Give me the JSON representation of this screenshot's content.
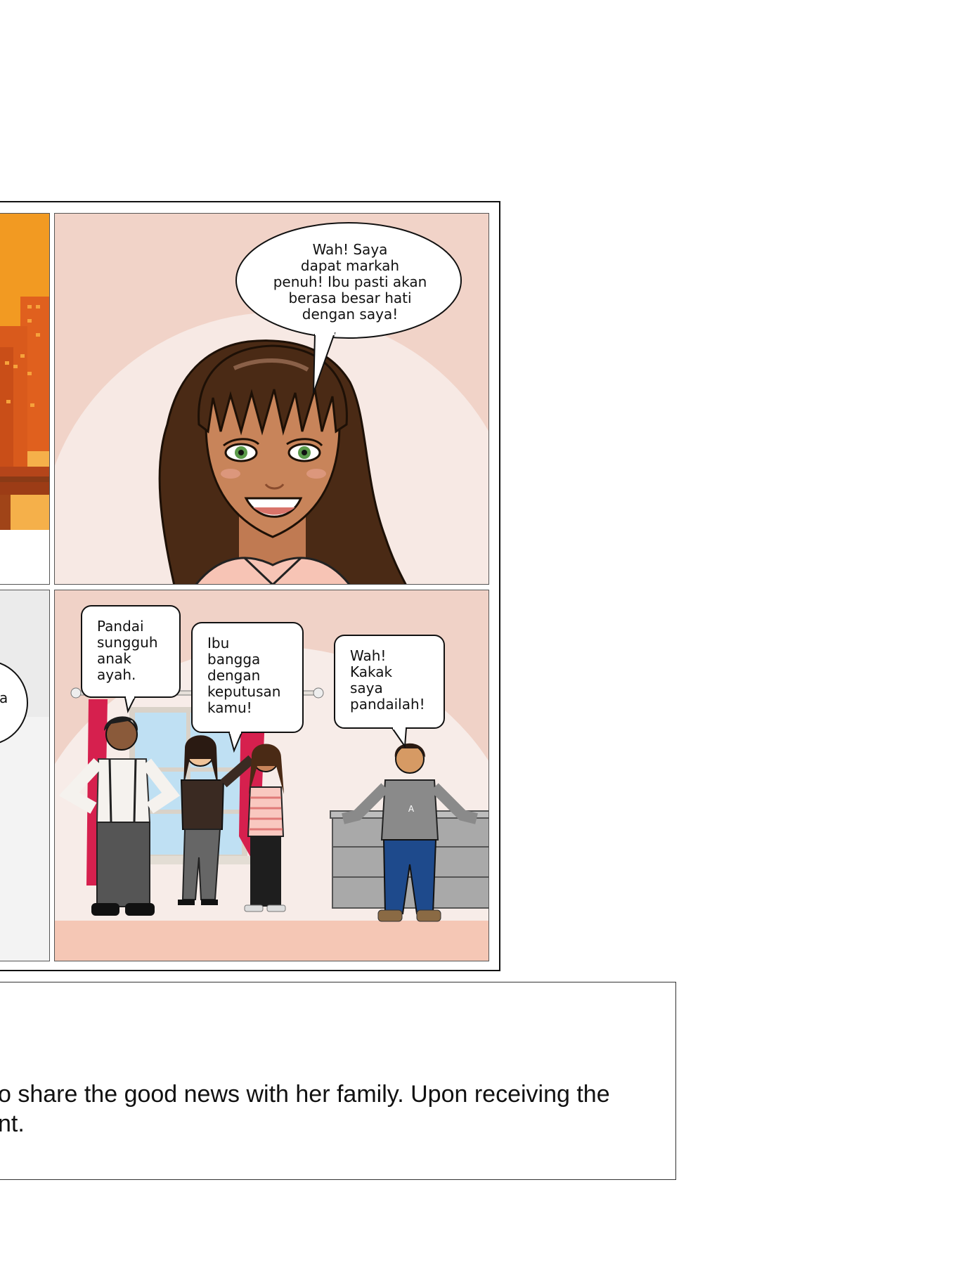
{
  "comic": {
    "panel_top_right": {
      "speech": "Wah! Saya\ndapat markah\npenuh! Ibu pasti akan\nberasa besar hati\ndengan saya!"
    },
    "panel_bottom_left": {
      "speech_fragment": "a"
    },
    "panel_bottom_right": {
      "speech_father": "Pandai\nsungguh\nanak\nayah.",
      "speech_mother": "Ibu\nbangga\ndengan\nkeputusan\nkamu!",
      "speech_brother": "Wah!\nKakak\nsaya\npandailah!",
      "hoodie_letter": "A"
    }
  },
  "caption": {
    "text": "o share the good news with her family. Upon receiving the\nnt."
  }
}
